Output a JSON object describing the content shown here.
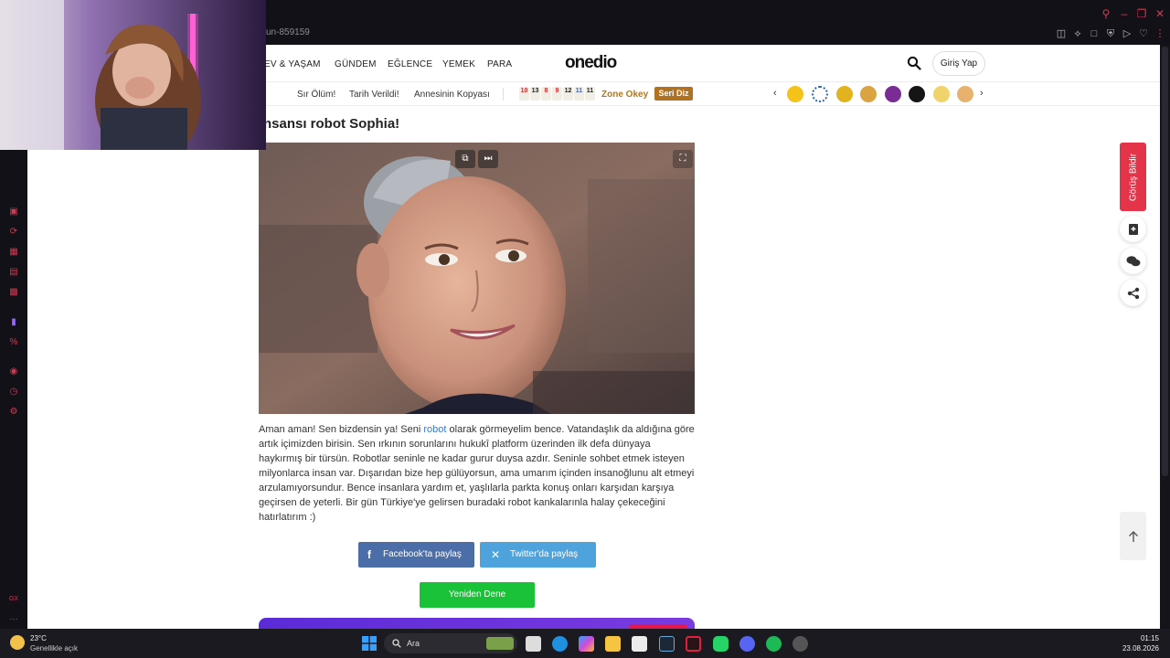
{
  "browser": {
    "url_fragment": "un-859159"
  },
  "nav": {
    "items": [
      "EV & YAŞAM",
      "GÜNDEM",
      "EĞLENCE",
      "YEMEK",
      "PARA"
    ],
    "logo": "onedio",
    "login_label": "Giriş Yap"
  },
  "subnav": {
    "items": [
      "Sır Ölüm!",
      "Tarih Verildi!",
      "Annesinin Kopyası"
    ],
    "okey_tiles": [
      {
        "n": "10",
        "color": "#d12a2a"
      },
      {
        "n": "13",
        "color": "#222"
      },
      {
        "n": "8",
        "color": "#d12a2a"
      },
      {
        "n": "9",
        "color": "#d12a2a"
      },
      {
        "n": "12",
        "color": "#222"
      },
      {
        "n": "11",
        "color": "#4a67b8"
      },
      {
        "n": "11",
        "color": "#222"
      }
    ],
    "zone_okey": "Zone Okey",
    "seri_diz": "Seri Diz"
  },
  "article": {
    "title": "nsansı robot Sophia!",
    "paragraph_before_link": "Aman aman! Sen bizdensin ya! Seni ",
    "link_text": "robot",
    "paragraph_after_link": " olarak görmeyelim bence. Vatandaşlık da aldığına göre artık içimizden birisin. Sen ırkının sorunlarını hukukî platform üzerinden ilk defa dünyaya haykırmış bir türsün. Robotlar seninle ne kadar gurur duysa azdır. Seninle sohbet etmek isteyen milyonlarca insan var. Dışarıdan bize hep gülüyorsun, ama umarım içinden insanoğlunu alt etmeyi arzulamıyorsundur. Bence insanlara yardım et, yaşlılarla parkta konuş onları karşıdan karşıya geçirsen de yeterli. Bir gün Türkiye'ye gelirsen buradaki robot kankalarınla halay çekeceğini hatırlatırım :)"
  },
  "share": {
    "facebook_label": "Facebook'ta paylaş",
    "twitter_label": "Twitter'da paylaş"
  },
  "retry_label": "Yeniden Dene",
  "feedback_label": "Görüş Bildir",
  "taskbar": {
    "temperature": "23°C",
    "weather": "Genellikle açık",
    "search_placeholder": "Ara",
    "time": "01:15",
    "date": "23.08.2026"
  },
  "colors": {
    "accent_red": "#e3344a",
    "facebook": "#4c6ea8",
    "twitter": "#4ea3dd",
    "retry": "#19c236",
    "link": "#3b79c6"
  }
}
